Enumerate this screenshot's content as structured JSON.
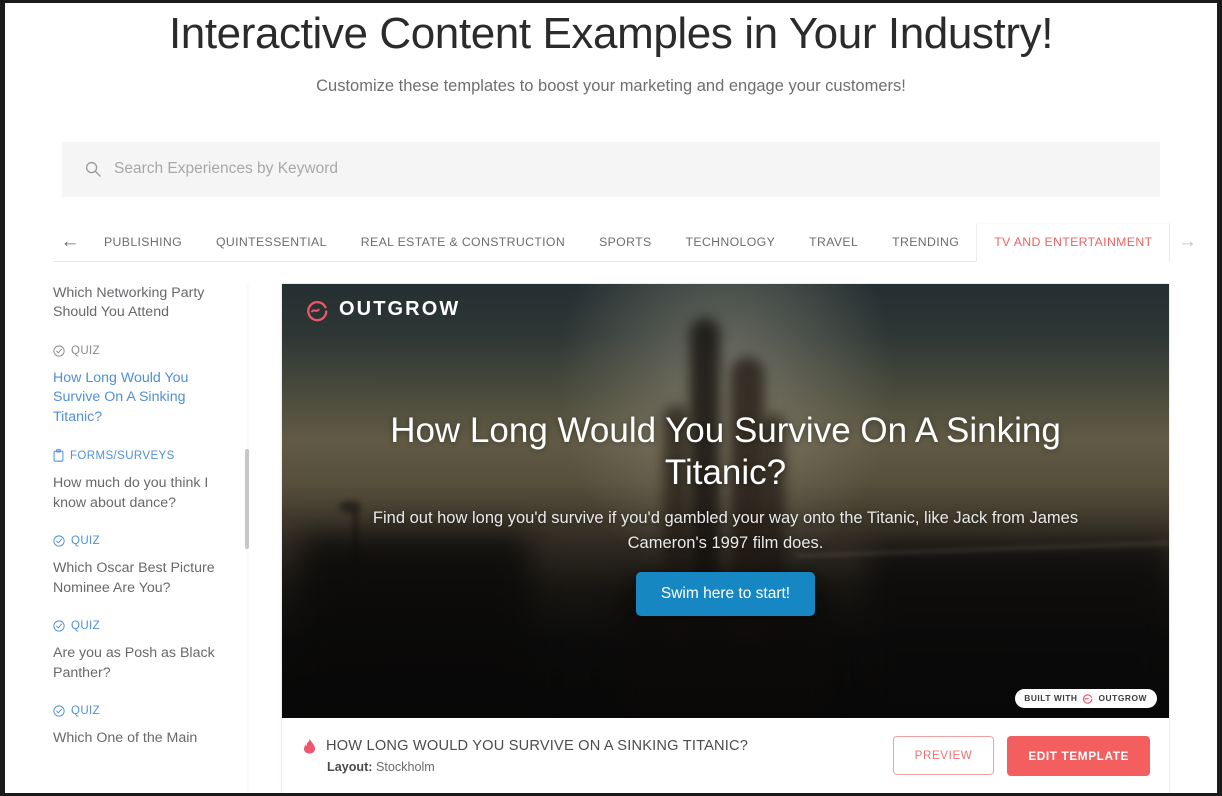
{
  "header": {
    "title": "Interactive Content Examples in Your Industry!",
    "subtitle": "Customize these templates to boost your marketing and engage your customers!"
  },
  "search": {
    "placeholder": "Search Experiences by Keyword",
    "value": "",
    "icon": "search-icon"
  },
  "tabs": {
    "prev_arrow": "←",
    "next_arrow": "→",
    "items": [
      {
        "label": "PUBLISHING",
        "active": false
      },
      {
        "label": "QUINTESSENTIAL",
        "active": false
      },
      {
        "label": "REAL ESTATE & CONSTRUCTION",
        "active": false
      },
      {
        "label": "SPORTS",
        "active": false
      },
      {
        "label": "TECHNOLOGY",
        "active": false
      },
      {
        "label": "TRAVEL",
        "active": false
      },
      {
        "label": "TRENDING",
        "active": false
      },
      {
        "label": "TV AND ENTERTAINMENT",
        "active": true
      }
    ],
    "active_color": "#ef6262"
  },
  "sidebar": {
    "items": [
      {
        "kicker": "",
        "icon": "",
        "title": "Which Networking Party Should You Attend",
        "selected": false
      },
      {
        "kicker": "QUIZ",
        "icon": "check-circle-icon",
        "title": "How Long Would You Survive On A Sinking Titanic?",
        "selected": true
      },
      {
        "kicker": "FORMS/SURVEYS",
        "icon": "clipboard-icon",
        "title": "How much do you think I know about dance?",
        "selected": false
      },
      {
        "kicker": "QUIZ",
        "icon": "check-circle-icon",
        "title": "Which Oscar Best Picture Nominee Are You?",
        "selected": false
      },
      {
        "kicker": "QUIZ",
        "icon": "check-circle-icon",
        "title": "Are you as Posh as Black Panther?",
        "selected": false
      },
      {
        "kicker": "QUIZ",
        "icon": "check-circle-icon",
        "title": "Which One of the Main",
        "selected": false
      }
    ],
    "link_color": "#4f90d8"
  },
  "preview": {
    "brand": "OUTGROW",
    "hero_title": "How Long Would You Survive On A Sinking Titanic?",
    "hero_subtitle": "Find out how long you'd survive if you'd gambled your way onto the Titanic, like Jack from James Cameron's 1997 film does.",
    "cta_label": "Swim here to start!",
    "cta_color": "#1787c4",
    "badge_text": "BUILT WITH",
    "badge_brand": "OUTGROW",
    "brand_color": "#f0566b"
  },
  "footer": {
    "flame_icon": "flame-icon",
    "title": "HOW LONG WOULD YOU SURVIVE ON A SINKING TITANIC?",
    "layout_label": "Layout:",
    "layout_value": "Stockholm",
    "preview_label": "PREVIEW",
    "edit_label": "EDIT TEMPLATE",
    "edit_color": "#f35f5f"
  }
}
